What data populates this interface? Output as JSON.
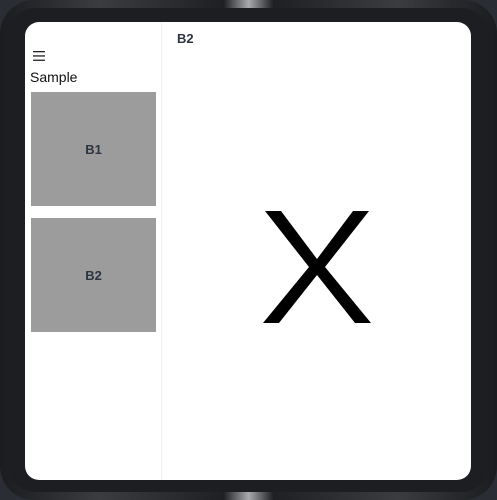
{
  "sidebar": {
    "title": "Sample",
    "items": [
      {
        "label": "B1"
      },
      {
        "label": "B2"
      }
    ]
  },
  "content": {
    "title": "B2",
    "symbol": "X"
  },
  "icons": {
    "menu": "hamburger-menu-icon"
  },
  "colors": {
    "tile_background": "#9c9c9c",
    "tile_text": "#2e3440",
    "screen_background": "#ffffff"
  }
}
